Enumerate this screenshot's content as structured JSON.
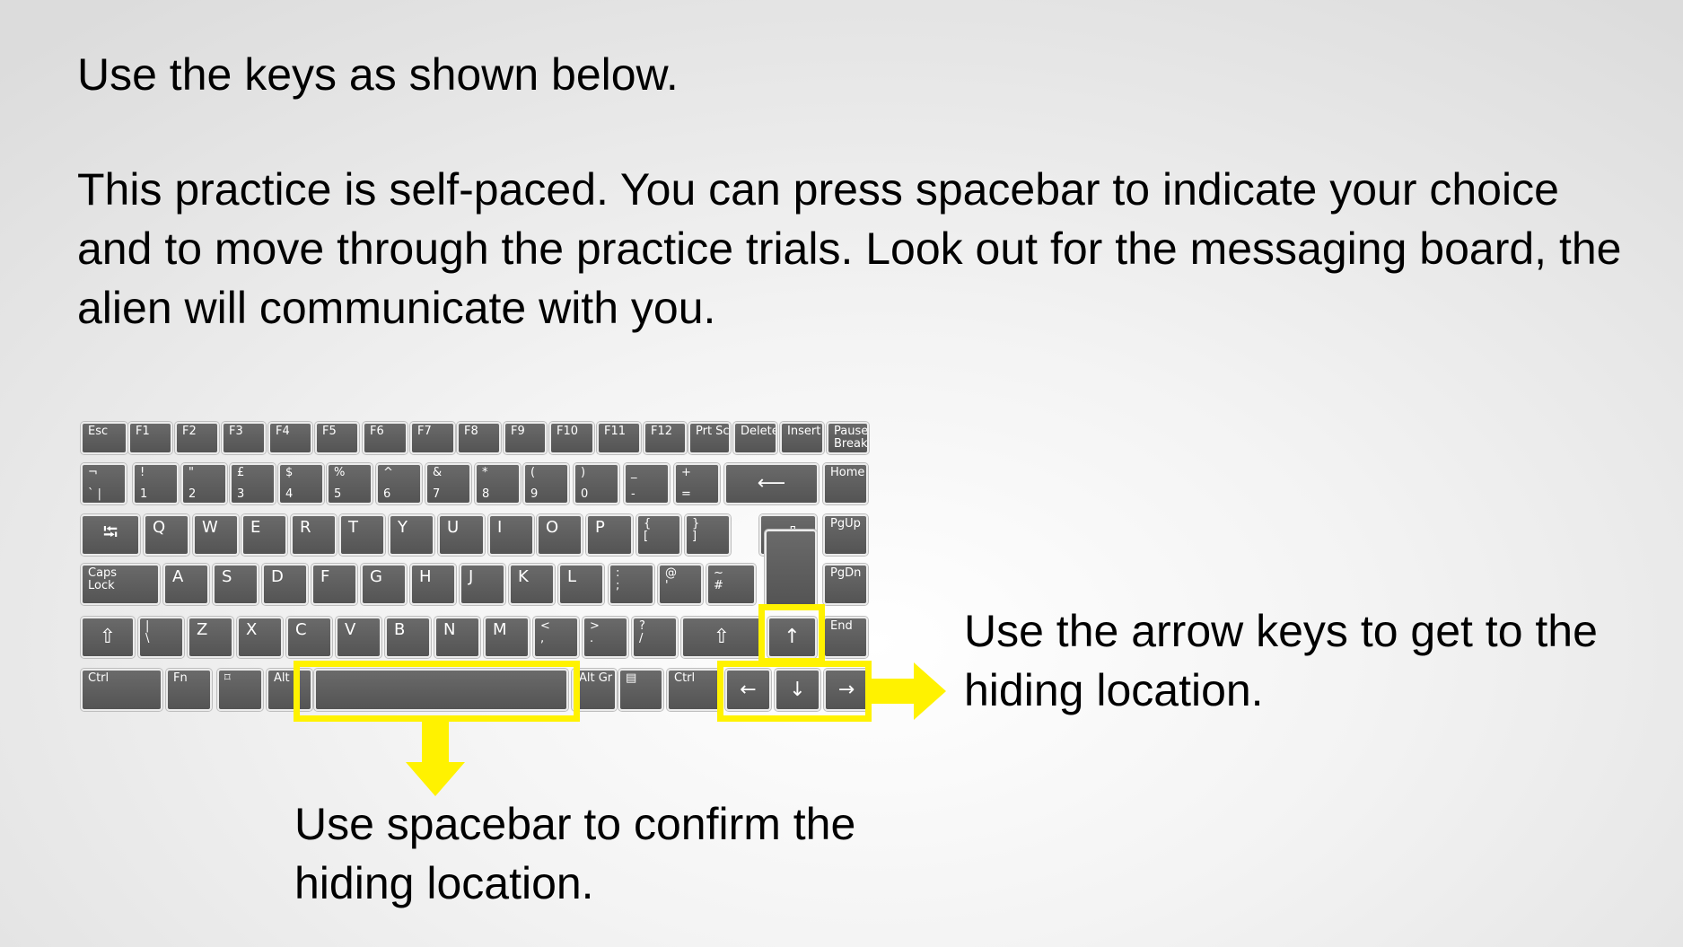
{
  "slide": {
    "heading": "Use the keys as shown below.",
    "paragraph": "This practice is self-paced. You can press spacebar to indicate your choice and to move through the practice trials. Look out for the messaging board, the alien will communicate with you.",
    "arrow_caption": "Use the arrow keys to get to the hiding location.",
    "space_caption": "Use spacebar to confirm the hiding location."
  },
  "colors": {
    "highlight": "#fff200",
    "key_fill": "#5e5e5e",
    "key_text": "#ffffff",
    "secondary_legend": "#5a63d8"
  },
  "keyboard": {
    "function_row": [
      "Esc",
      "F1",
      "F2",
      "F3",
      "F4",
      "F5",
      "F6",
      "F7",
      "F8",
      "F9",
      "F10",
      "F11",
      "F12",
      "Prt Sc",
      "Delete",
      "Insert",
      "Pause\nBreak"
    ],
    "number_row": [
      {
        "top": "¬",
        "bot": "` |"
      },
      {
        "top": "!",
        "bot": "1"
      },
      {
        "top": "\"",
        "bot": "2"
      },
      {
        "top": "£",
        "bot": "3"
      },
      {
        "top": "$",
        "bot": "4"
      },
      {
        "top": "%",
        "bot": "5"
      },
      {
        "top": "^",
        "bot": "6"
      },
      {
        "top": "&",
        "bot": "7"
      },
      {
        "top": "*",
        "bot": "8"
      },
      {
        "top": "(",
        "bot": "9"
      },
      {
        "top": ")",
        "bot": "0"
      },
      {
        "top": "_",
        "bot": "-"
      },
      {
        "top": "+",
        "bot": "="
      },
      {
        "glyph": "⟵"
      },
      {
        "top": "Home",
        "bot": ""
      }
    ],
    "qwerty_row": [
      "⭾",
      "Q",
      "W",
      "E",
      "R",
      "T",
      "Y",
      "U",
      "I",
      "O",
      "P",
      "{\n[",
      "}\n]",
      "⏎",
      "PgUp"
    ],
    "home_row": [
      "Caps\nLock",
      "A",
      "S",
      "D",
      "F",
      "G",
      "H",
      "J",
      "K",
      "L",
      ":\n;",
      "@\n'",
      "~\n#",
      "PgDn"
    ],
    "shift_row": [
      "⇧",
      "|\n\\",
      "Z",
      "X",
      "C",
      "V",
      "B",
      "N",
      "M",
      "<\n,",
      ">\n.",
      "?\n/",
      "⇧",
      "↑",
      "End"
    ],
    "bottom_row": [
      "Ctrl",
      "Fn",
      "⌑",
      "Alt",
      "",
      "Alt Gr",
      "▤",
      "Ctrl",
      "←",
      "↓",
      "→"
    ]
  }
}
